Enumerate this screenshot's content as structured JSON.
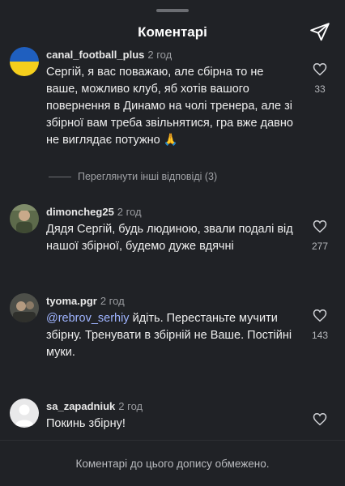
{
  "header": {
    "title": "Коментарі",
    "share_icon": "send-icon"
  },
  "comments": [
    {
      "username": "canal_football_plus",
      "time": "2 год",
      "text": "Сергій, я вас поважаю, але сбірна то не ваше, можливо клуб, яб хотів вашого повернення в Динамо на чолі тренера, але зі збірної вам треба звільнятися, гра вже давно не виглядає потужно 🙏",
      "likes": "33",
      "avatar": "ukraine-flag-avatar"
    },
    {
      "username": "dimoncheg25",
      "time": "2 год",
      "text": "Дядя Сергій, будь людиною, звали подалі від нашої збірної, будемо дуже вдячні",
      "likes": "277",
      "avatar": "user-photo-avatar"
    },
    {
      "username": "tyoma.pgr",
      "time": "2 год",
      "mention": "@rebrov_serhiy",
      "text": " йдіть. Перестаньте мучити збірну. Тренувати в збірній не Ваше. Постійні муки.",
      "likes": "143",
      "avatar": "user-photo-avatar"
    },
    {
      "username": "sa_zapadniuk",
      "time": "2 год",
      "text": "Покинь збірну!",
      "avatar": "default-avatar"
    }
  ],
  "replies_link": "Переглянути інші відповіді (3)",
  "footer": "Коментарі до цього допису обмежено.",
  "colors": {
    "background": "#202226",
    "mention": "#9fb4ff",
    "muted": "#9a9ca0"
  }
}
